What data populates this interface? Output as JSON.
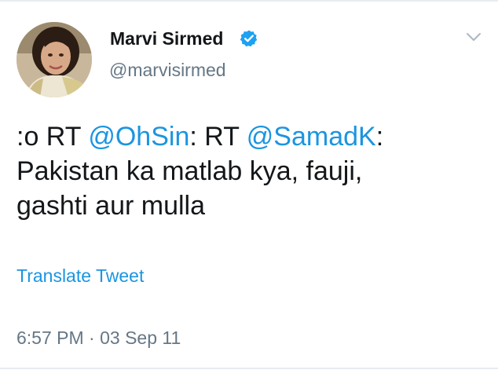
{
  "user": {
    "display_name": "Marvi Sirmed",
    "handle": "@marvisirmed",
    "verified_icon": "verified-badge-icon",
    "menu_icon": "chevron-down-icon"
  },
  "tweet": {
    "prefix": ":o RT ",
    "mention_1": "@OhSin",
    "middle": ": RT ",
    "mention_2": "@SamadK",
    "after_mention": ":",
    "line_2": "Pakistan ka matlab kya,  fauji,",
    "line_3": "gashti aur mulla"
  },
  "translate_label": "Translate Tweet",
  "timestamp": "6:57 PM · 03 Sep 11",
  "colors": {
    "link": "#1b95e0",
    "muted": "#657786",
    "text": "#14171a",
    "verified": "#1da1f2"
  }
}
